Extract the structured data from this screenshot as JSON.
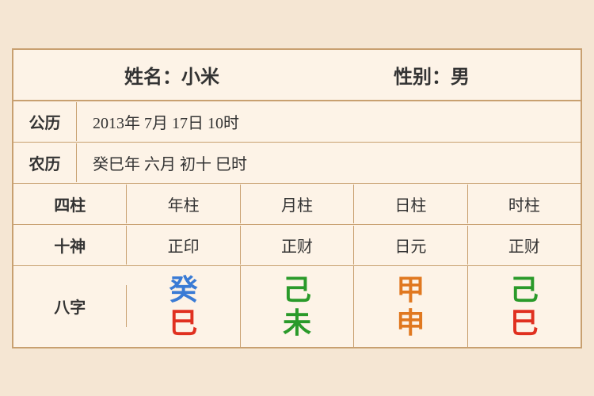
{
  "header": {
    "name_label": "姓名：小米",
    "gender_label": "性别：男"
  },
  "solar": {
    "label": "公历",
    "value": "2013年 7月 17日 10时"
  },
  "lunar": {
    "label": "农历",
    "value": "癸巳年 六月 初十 巳时"
  },
  "columns": {
    "header_label": "四柱",
    "items": [
      "年柱",
      "月柱",
      "日柱",
      "时柱"
    ]
  },
  "shishen": {
    "label": "十神",
    "items": [
      "正印",
      "正财",
      "日元",
      "正财"
    ]
  },
  "bazhi": {
    "label": "八字",
    "items": [
      {
        "top": "癸",
        "top_color": "color-blue",
        "bottom": "巳",
        "bottom_color": "color-red"
      },
      {
        "top": "己",
        "top_color": "color-green",
        "bottom": "未",
        "bottom_color": "color-green"
      },
      {
        "top": "甲",
        "top_color": "color-orange",
        "bottom": "申",
        "bottom_color": "color-orange"
      },
      {
        "top": "己",
        "top_color": "color-green",
        "bottom": "巳",
        "bottom_color": "color-red"
      }
    ]
  }
}
